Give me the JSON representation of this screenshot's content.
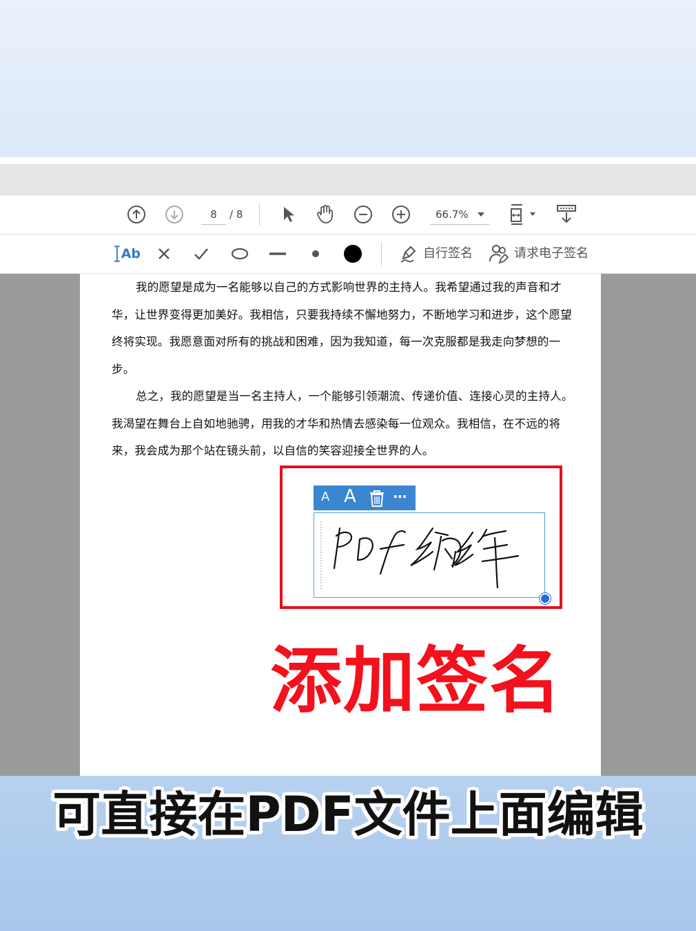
{
  "nav_toolbar": {
    "current_page": "8",
    "total_pages": "/ 8",
    "zoom": "66.7%",
    "icons": [
      "prev-page-icon",
      "next-page-icon",
      "select-pointer-icon",
      "hand-pan-icon",
      "zoom-out-icon",
      "zoom-in-icon",
      "dropdown-arrow-icon",
      "fit-page-icon",
      "scroll-mode-icon"
    ]
  },
  "sign_toolbar": {
    "add_text": "Ab",
    "fill_sign_label": "自行签名",
    "request_esign_label": "请求电子签名",
    "icons": [
      "add-text-icon",
      "cross-mark-icon",
      "check-mark-icon",
      "ellipse-icon",
      "line-icon",
      "dot-icon",
      "color-swatch-icon",
      "fill-sign-pen-icon",
      "request-signature-icon"
    ],
    "color_swatch": "#000000"
  },
  "document": {
    "paragraphs": [
      "我的愿望是成为一名能够以自己的方式影响世界的主持人。我希望通过我的声音和才华，让世界变得更加美好。我相信，只要我持续不懈地努力，不断地学习和进步，这个愿望终将实现。我愿意面对所有的挑战和困难，因为我知道，每一次克服都是我走向梦想的一步。",
      "总之，我的愿望是当一名主持人，一个能够引领潮流、传递价值、连接心灵的主持人。我渴望在舞台上自如地驰骋，用我的才华和热情去感染每一位观众。我相信，在不远的将来，我会成为那个站在镜头前，以自信的笑容迎接全世界的人。"
    ]
  },
  "signature": {
    "toolbar": {
      "decrease_font": "A",
      "increase_font": "A",
      "more": "···"
    },
    "handwriting": "PDF编辑",
    "accent_color": "#3b86d0"
  },
  "overlay": {
    "highlight_text": "添加签名",
    "highlight_color": "#f2111c",
    "caption": "可直接在PDF文件上面编辑"
  }
}
